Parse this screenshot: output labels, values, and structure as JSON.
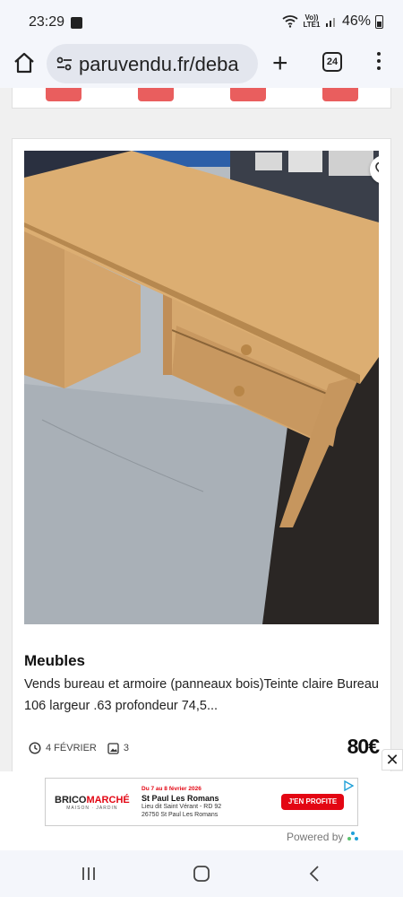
{
  "status_bar": {
    "time": "23:29",
    "network": "Vo)) LTE1",
    "battery": "46%"
  },
  "browser": {
    "url": "paruvendu.fr/deba",
    "tab_count": "24"
  },
  "listing": {
    "category": "Meubles",
    "description": "Vends bureau et armoire (panneaux bois)Teinte claire Bureau 106 largeur .63 profondeur 74,5...",
    "date": "4 FÉVRIER",
    "photo_count": "3",
    "price": "80€"
  },
  "ad": {
    "brand_part1": "BRICO",
    "brand_part2": "MARCHÉ",
    "brand_tagline": "MAISON · JARDIN",
    "dates": "Du 7 au 8 février 2026",
    "store": "St Paul Les Romans",
    "address_line1": "Lieu dit Saint Vérant - RD 92",
    "address_line2": "26750 St Paul Les Romans",
    "cta": "J'EN PROFITE",
    "powered_by": "Powered by"
  },
  "colors": {
    "accent": "#e95e5e",
    "ad_red": "#e30613"
  }
}
